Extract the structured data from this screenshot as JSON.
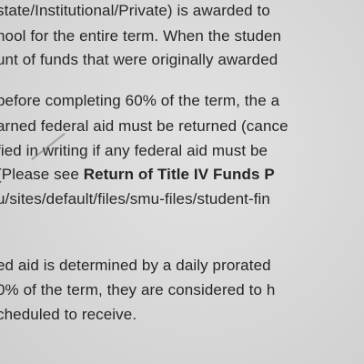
{
  "document": {
    "lines": [
      "state/Institutional/Private) is awarded to",
      "hool for the entire term. When the studen",
      "unt of funds that were originally awarded",
      "before completing 60% of the term, the a",
      "arned federal aid must be returned (cance",
      "fied in writing if any federal aid must be",
      "(Please see ",
      "Return of Title IV Funds P",
      "u/sites/default/files/smu-files/student-fin",
      "ed aid is determined by a daily prorated",
      "0% of the term, they are considered to h",
      "cheduled to receive."
    ]
  }
}
